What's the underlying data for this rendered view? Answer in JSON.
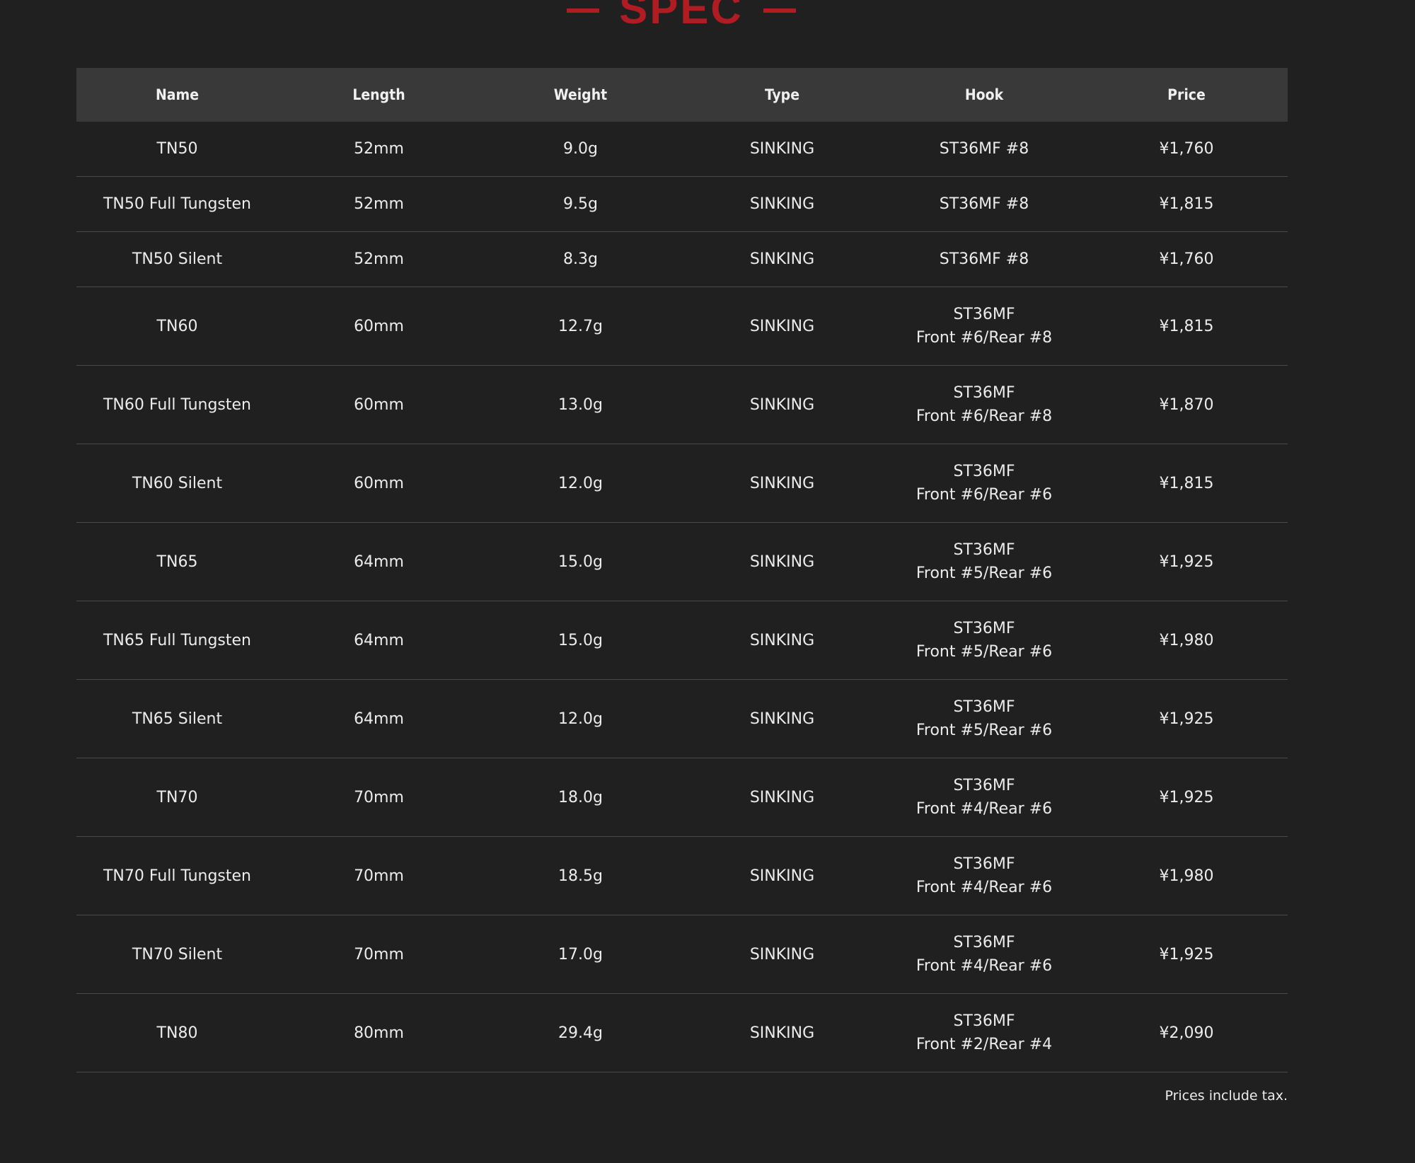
{
  "heading": "SPEC",
  "table": {
    "headers": [
      "Name",
      "Length",
      "Weight",
      "Type",
      "Hook",
      "Price"
    ],
    "rows": [
      {
        "name": "TN50",
        "length": "52mm",
        "weight": "9.0g",
        "type": "SINKING",
        "hook_1": "ST36MF #8",
        "hook_2": "",
        "price": "¥1,760"
      },
      {
        "name": "TN50 Full Tungsten",
        "length": "52mm",
        "weight": "9.5g",
        "type": "SINKING",
        "hook_1": "ST36MF #8",
        "hook_2": "",
        "price": "¥1,815"
      },
      {
        "name": "TN50 Silent",
        "length": "52mm",
        "weight": "8.3g",
        "type": "SINKING",
        "hook_1": "ST36MF #8",
        "hook_2": "",
        "price": "¥1,760"
      },
      {
        "name": "TN60",
        "length": "60mm",
        "weight": "12.7g",
        "type": "SINKING",
        "hook_1": "ST36MF",
        "hook_2": "Front #6/Rear #8",
        "price": "¥1,815"
      },
      {
        "name": "TN60 Full Tungsten",
        "length": "60mm",
        "weight": "13.0g",
        "type": "SINKING",
        "hook_1": "ST36MF",
        "hook_2": "Front #6/Rear #8",
        "price": "¥1,870"
      },
      {
        "name": "TN60 Silent",
        "length": "60mm",
        "weight": "12.0g",
        "type": "SINKING",
        "hook_1": "ST36MF",
        "hook_2": "Front #6/Rear #6",
        "price": "¥1,815"
      },
      {
        "name": "TN65",
        "length": "64mm",
        "weight": "15.0g",
        "type": "SINKING",
        "hook_1": "ST36MF",
        "hook_2": "Front #5/Rear #6",
        "price": "¥1,925"
      },
      {
        "name": "TN65 Full Tungsten",
        "length": "64mm",
        "weight": "15.0g",
        "type": "SINKING",
        "hook_1": "ST36MF",
        "hook_2": "Front #5/Rear #6",
        "price": "¥1,980"
      },
      {
        "name": "TN65 Silent",
        "length": "64mm",
        "weight": "12.0g",
        "type": "SINKING",
        "hook_1": "ST36MF",
        "hook_2": "Front #5/Rear #6",
        "price": "¥1,925"
      },
      {
        "name": "TN70",
        "length": "70mm",
        "weight": "18.0g",
        "type": "SINKING",
        "hook_1": "ST36MF",
        "hook_2": "Front #4/Rear #6",
        "price": "¥1,925"
      },
      {
        "name": "TN70 Full Tungsten",
        "length": "70mm",
        "weight": "18.5g",
        "type": "SINKING",
        "hook_1": "ST36MF",
        "hook_2": "Front #4/Rear #6",
        "price": "¥1,980"
      },
      {
        "name": "TN70 Silent",
        "length": "70mm",
        "weight": "17.0g",
        "type": "SINKING",
        "hook_1": "ST36MF",
        "hook_2": "Front #4/Rear #6",
        "price": "¥1,925"
      },
      {
        "name": "TN80",
        "length": "80mm",
        "weight": "29.4g",
        "type": "SINKING",
        "hook_1": "ST36MF",
        "hook_2": "Front #2/Rear #4",
        "price": "¥2,090"
      }
    ]
  },
  "tax_note": "Prices include tax.",
  "colors": {
    "background": "#202020",
    "header_row": "#393939",
    "accent": "#b01c22",
    "row_divider": "#4a4a4a"
  }
}
